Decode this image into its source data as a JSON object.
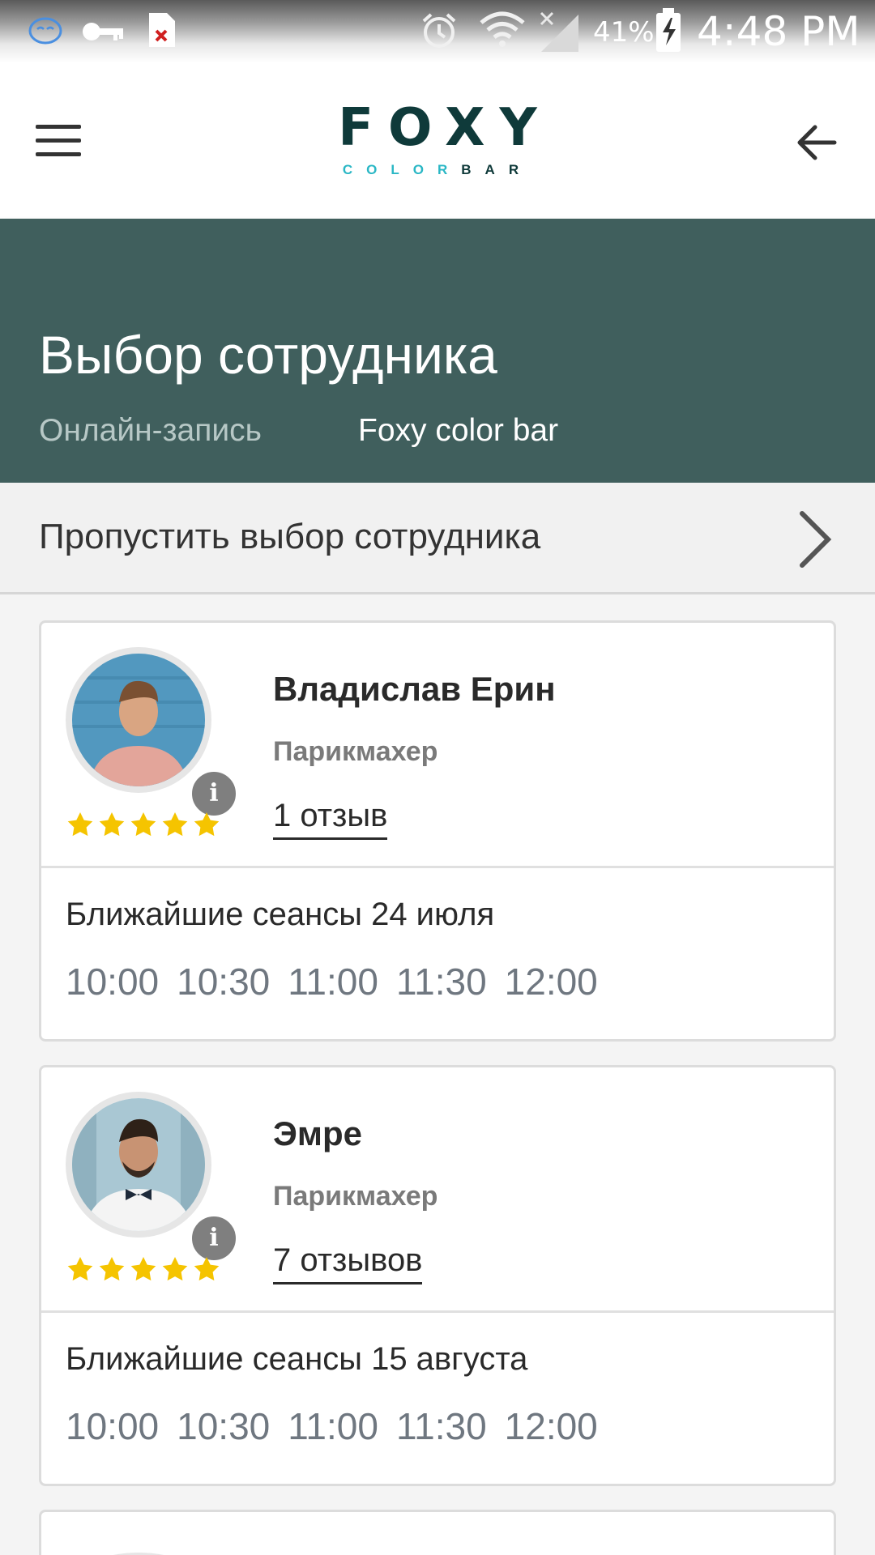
{
  "status_bar": {
    "battery": "41%",
    "time": "4:48 PM",
    "icons": [
      "smiley-notification-icon",
      "key-icon",
      "file-error-icon",
      "alarm-icon",
      "wifi-icon",
      "signal-icon",
      "battery-charging-icon"
    ]
  },
  "header": {
    "logo_main": "FOXY",
    "logo_sub_color": "COLOR",
    "logo_sub_bar": "BAR",
    "menu_icon": "hamburger-menu-icon",
    "back_icon": "arrow-left-icon"
  },
  "hero": {
    "title": "Выбор сотрудника",
    "breadcrumb_1": "Онлайн-запись",
    "breadcrumb_2": "Foxy color bar"
  },
  "skip": {
    "label": "Пропустить выбор сотрудника",
    "icon": "chevron-right-icon"
  },
  "staff": [
    {
      "name": "Владислав Ерин",
      "role": "Парикмахер",
      "reviews": "1 отзыв",
      "rating": 5,
      "sessions_title": "Ближайшие сеансы 24 июля",
      "slots": [
        "10:00",
        "10:30",
        "11:00",
        "11:30",
        "12:00"
      ]
    },
    {
      "name": "Эмре",
      "role": "Парикмахер",
      "reviews": "7 отзывов",
      "rating": 5,
      "sessions_title": "Ближайшие сеансы 15 августа",
      "slots": [
        "10:00",
        "10:30",
        "11:00",
        "11:30",
        "12:00"
      ]
    }
  ],
  "colors": {
    "hero_bg": "#405f5d",
    "logo_dark": "#0f3a3a",
    "logo_accent": "#2ab7c5",
    "star": "#f5c400",
    "time_slot": "#6f7780"
  }
}
